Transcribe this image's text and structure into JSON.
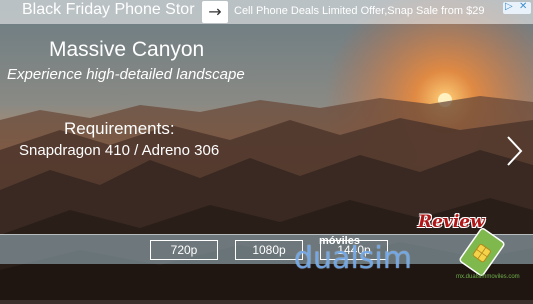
{
  "ad": {
    "headline": "Black Friday Phone Stor",
    "description": "Cell Phone Deals Limited Offer,Snap Sale from $29"
  },
  "scene": {
    "title": "Massive Canyon",
    "subtitle": "Experience high-detailed landscape"
  },
  "requirements": {
    "heading": "Requirements:",
    "value": "Snapdragon 410 / Adreno 306"
  },
  "resolutions": [
    "720p",
    "1080p",
    "1440p"
  ],
  "watermark": {
    "review": "Review",
    "moviles": "móviles",
    "brand": "dualsim",
    "url": "mx.dualsimmoviles.com"
  },
  "colors": {
    "sky_top": "#6a7d86",
    "sunset_orange": "#e98a3a",
    "terrain_dark": "#2b211c",
    "resolution_bar": "#a5c3cd",
    "brand_blue": "#64a0e6",
    "review_red": "#b01818"
  },
  "icons": {
    "ad_arrow": "arrow-right-icon",
    "next": "chevron-right-icon",
    "adchoices": "adchoices-icon",
    "ad_close": "close-icon"
  }
}
